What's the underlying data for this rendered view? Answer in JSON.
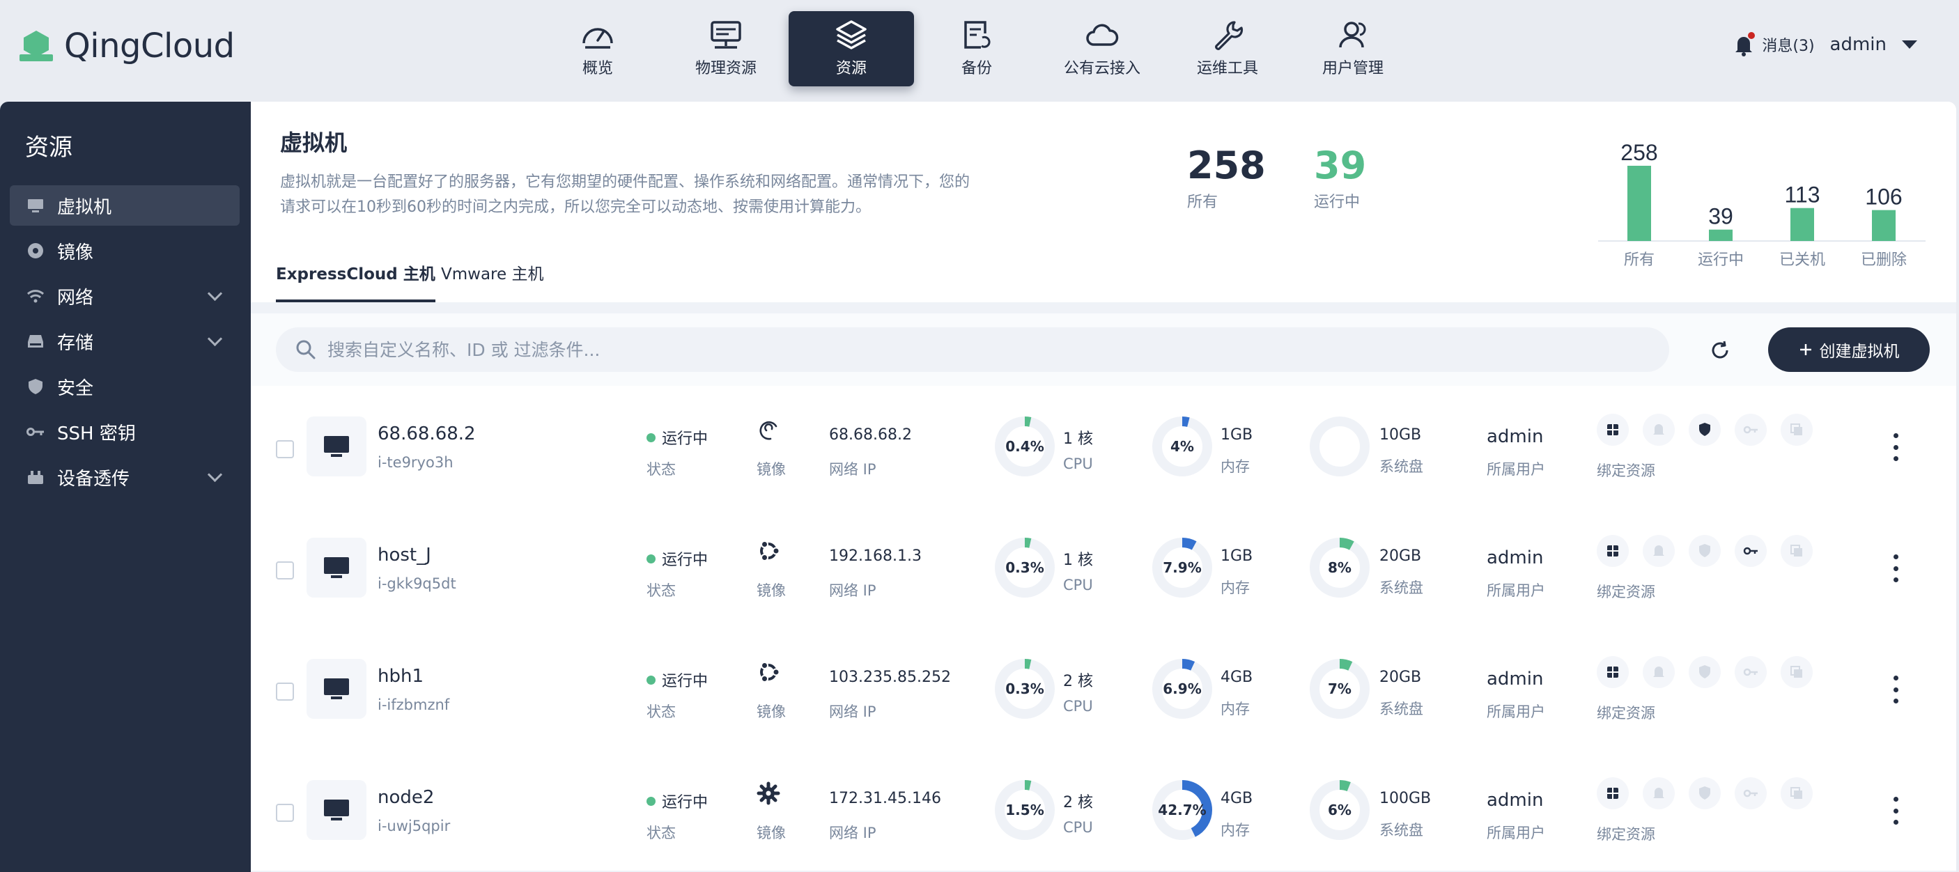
{
  "app": {
    "brand": "QingCloud"
  },
  "nav": [
    {
      "label": "概览",
      "icon": "dashboard-icon"
    },
    {
      "label": "物理资源",
      "icon": "server-icon"
    },
    {
      "label": "资源",
      "icon": "layers-icon",
      "active": true
    },
    {
      "label": "备份",
      "icon": "backup-icon"
    },
    {
      "label": "公有云接入",
      "icon": "cloud-icon"
    },
    {
      "label": "运维工具",
      "icon": "wrench-icon"
    },
    {
      "label": "用户管理",
      "icon": "users-icon"
    }
  ],
  "user": {
    "messages": "消息(3)",
    "name": "admin"
  },
  "sidebar": {
    "title": "资源",
    "items": [
      {
        "label": "虚拟机",
        "icon": "monitor-icon",
        "active": true,
        "expandable": false
      },
      {
        "label": "镜像",
        "icon": "disc-icon",
        "expandable": false
      },
      {
        "label": "网络",
        "icon": "wifi-icon",
        "expandable": true
      },
      {
        "label": "存储",
        "icon": "storage-icon",
        "expandable": true
      },
      {
        "label": "安全",
        "icon": "shield-icon",
        "expandable": false
      },
      {
        "label": "SSH 密钥",
        "icon": "key-icon",
        "expandable": false
      },
      {
        "label": "设备透传",
        "icon": "device-icon",
        "expandable": true
      }
    ]
  },
  "header": {
    "title": "虚拟机",
    "description": "虚拟机就是一台配置好了的服务器，它有您期望的硬件配置、操作系统和网络配置。通常情况下，您的请求可以在10秒到60秒的时间之内完成，所以您完全可以动态地、按需使用计算能力。",
    "stats": [
      {
        "value": "258",
        "label": "所有",
        "color": "#242e42"
      },
      {
        "value": "39",
        "label": "运行中",
        "color": "#55bc8a"
      }
    ]
  },
  "tabs": [
    {
      "label": "ExpressCloud 主机",
      "active": true
    },
    {
      "label": "Vmware 主机",
      "active": false
    }
  ],
  "chart_data": {
    "type": "bar",
    "categories": [
      "所有",
      "运行中",
      "已关机",
      "已删除"
    ],
    "values": [
      258,
      39,
      113,
      106
    ],
    "ylim": [
      0,
      258
    ],
    "color": "#55bc8a",
    "title": "",
    "xlabel": "",
    "ylabel": "",
    "grid": false
  },
  "toolbar": {
    "search_placeholder": "搜索自定义名称、ID 或 过滤条件...",
    "create_label": "创建虚拟机"
  },
  "labels": {
    "status": "状态",
    "image": "镜像",
    "ip": "网络 IP",
    "cpu": "CPU",
    "memory": "内存",
    "disk": "系统盘",
    "owner": "所属用户",
    "bind": "绑定资源"
  },
  "colors": {
    "accent": "#242e42",
    "running": "#55bc8a",
    "memory": "#3471d0"
  },
  "rows": [
    {
      "name": "68.68.68.2",
      "id": "i-te9ryo3h",
      "status": "运行中",
      "image_icon": "debian-icon",
      "ip": "68.68.68.2",
      "cpu_pct": "0.4%",
      "cpu_frac": 0.004,
      "cpu": "1 核",
      "mem_pct": "4%",
      "mem_frac": 0.04,
      "mem": "1GB",
      "disk_pct": "",
      "disk_frac": 0,
      "disk": "10GB",
      "owner": "admin",
      "bind_active": [
        true,
        false,
        true,
        false,
        false
      ]
    },
    {
      "name": "host_J",
      "id": "i-gkk9q5dt",
      "status": "运行中",
      "image_icon": "ubuntu-icon",
      "ip": "192.168.1.3",
      "cpu_pct": "0.3%",
      "cpu_frac": 0.003,
      "cpu": "1 核",
      "mem_pct": "7.9%",
      "mem_frac": 0.079,
      "mem": "1GB",
      "disk_pct": "8%",
      "disk_frac": 0.08,
      "disk": "20GB",
      "owner": "admin",
      "bind_active": [
        true,
        false,
        false,
        true,
        false
      ]
    },
    {
      "name": "hbh1",
      "id": "i-ifzbmznf",
      "status": "运行中",
      "image_icon": "ubuntu-icon",
      "ip": "103.235.85.252",
      "cpu_pct": "0.3%",
      "cpu_frac": 0.003,
      "cpu": "2 核",
      "mem_pct": "6.9%",
      "mem_frac": 0.069,
      "mem": "4GB",
      "disk_pct": "7%",
      "disk_frac": 0.07,
      "disk": "20GB",
      "owner": "admin",
      "bind_active": [
        true,
        false,
        false,
        false,
        false
      ]
    },
    {
      "name": "node2",
      "id": "i-uwj5qpir",
      "status": "运行中",
      "image_icon": "gear-os-icon",
      "ip": "172.31.45.146",
      "cpu_pct": "1.5%",
      "cpu_frac": 0.015,
      "cpu": "2 核",
      "mem_pct": "42.7%",
      "mem_frac": 0.427,
      "mem": "4GB",
      "disk_pct": "6%",
      "disk_frac": 0.06,
      "disk": "100GB",
      "owner": "admin",
      "bind_active": [
        true,
        false,
        false,
        false,
        false
      ]
    }
  ],
  "bind_icons": [
    "vxnet-icon",
    "alarm-icon",
    "security-group-icon",
    "keypair-icon",
    "volume-icon"
  ]
}
